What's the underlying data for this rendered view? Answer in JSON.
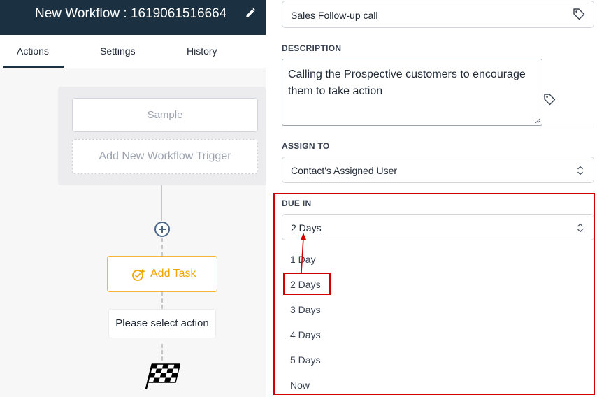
{
  "workflow": {
    "title": "New Workflow : 1619061516664",
    "tabs": [
      "Actions",
      "Settings",
      "History"
    ],
    "active_tab": "Actions"
  },
  "canvas": {
    "trigger_sample": "Sample",
    "add_trigger_label": "Add New Workflow Trigger",
    "add_task_label": "Add Task",
    "select_action_label": "Please select action"
  },
  "form": {
    "task_name_value": "Sales Follow-up call",
    "description_label": "DESCRIPTION",
    "description_value": "Calling the Prospective customers to encourage them to take action",
    "assign_to_label": "ASSIGN TO",
    "assign_to_value": "Contact's Assigned User",
    "due_in_label": "DUE IN",
    "due_in_value": "2 Days",
    "due_in_options": [
      "1 Day",
      "2 Days",
      "3 Days",
      "4 Days",
      "5 Days",
      "Now"
    ]
  },
  "colors": {
    "header_bg": "#1b3142",
    "accent_orange": "#f0a500",
    "highlight_red": "#d40000"
  }
}
